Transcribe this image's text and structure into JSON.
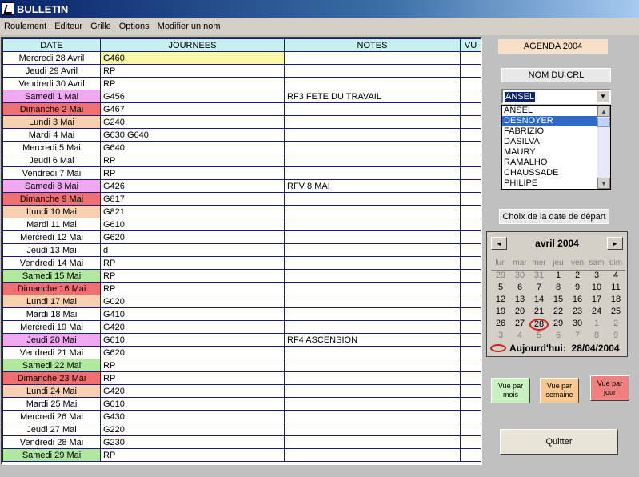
{
  "window": {
    "title": "BULLETIN"
  },
  "menu": [
    "Roulement",
    "Editeur",
    "Grille",
    "Options",
    "Modifier un nom"
  ],
  "grid": {
    "columns": [
      "DATE",
      "JOURNEES",
      "NOTES",
      "VU"
    ],
    "rows": [
      {
        "date": "Mercredi 28 Avril",
        "journee": "G460",
        "notes": "",
        "date_color": "#ffffff",
        "journee_color": "#f8f8a8"
      },
      {
        "date": "Jeudi 29 Avril",
        "journee": "RP",
        "notes": "",
        "date_color": "#ffffff"
      },
      {
        "date": "Vendredi 30 Avril",
        "journee": "RP",
        "notes": "",
        "date_color": "#ffffff"
      },
      {
        "date": "Samedi 1 Mai",
        "journee": "G456",
        "notes": "RF3 FETE DU TRAVAIL",
        "date_color": "#f0a8f0"
      },
      {
        "date": "Dimanche 2 Mai",
        "journee": "G467",
        "notes": "",
        "date_color": "#f07070"
      },
      {
        "date": "Lundi 3 Mai",
        "journee": "G240",
        "notes": "",
        "date_color": "#f8d0b0"
      },
      {
        "date": "Mardi 4 Mai",
        "journee": "G630 G640",
        "notes": "",
        "date_color": "#ffffff"
      },
      {
        "date": "Mercredi 5 Mai",
        "journee": "G640",
        "notes": "",
        "date_color": "#ffffff"
      },
      {
        "date": "Jeudi 6 Mai",
        "journee": "RP",
        "notes": "",
        "date_color": "#ffffff"
      },
      {
        "date": "Vendredi 7 Mai",
        "journee": "RP",
        "notes": "",
        "date_color": "#ffffff"
      },
      {
        "date": "Samedi 8 Mai",
        "journee": "G426",
        "notes": "RFV  8 MAI",
        "date_color": "#f0a8f0"
      },
      {
        "date": "Dimanche 9 Mai",
        "journee": "G817",
        "notes": "",
        "date_color": "#f07070"
      },
      {
        "date": "Lundi 10 Mai",
        "journee": "G821",
        "notes": "",
        "date_color": "#f8d0b0"
      },
      {
        "date": "Mardi 11 Mai",
        "journee": "G610",
        "notes": "",
        "date_color": "#ffffff"
      },
      {
        "date": "Mercredi 12 Mai",
        "journee": "G620",
        "notes": "",
        "date_color": "#ffffff"
      },
      {
        "date": "Jeudi 13 Mai",
        "journee": "d",
        "notes": "",
        "date_color": "#ffffff"
      },
      {
        "date": "Vendredi 14 Mai",
        "journee": "RP",
        "notes": "",
        "date_color": "#ffffff"
      },
      {
        "date": "Samedi 15 Mai",
        "journee": "RP",
        "notes": "",
        "date_color": "#b0e8a0"
      },
      {
        "date": "Dimanche 16 Mai",
        "journee": "RP",
        "notes": "",
        "date_color": "#f07070"
      },
      {
        "date": "Lundi 17 Mai",
        "journee": "G020",
        "notes": "",
        "date_color": "#f8d0b0"
      },
      {
        "date": "Mardi 18 Mai",
        "journee": "G410",
        "notes": "",
        "date_color": "#ffffff"
      },
      {
        "date": "Mercredi 19 Mai",
        "journee": "G420",
        "notes": "",
        "date_color": "#ffffff"
      },
      {
        "date": "Jeudi 20 Mai",
        "journee": "G610",
        "notes": "RF4  ASCENSION",
        "date_color": "#f0a8f0"
      },
      {
        "date": "Vendredi 21 Mai",
        "journee": "G620",
        "notes": "",
        "date_color": "#ffffff"
      },
      {
        "date": "Samedi 22 Mai",
        "journee": "RP",
        "notes": "",
        "date_color": "#b0e8a0"
      },
      {
        "date": "Dimanche 23 Mai",
        "journee": "RP",
        "notes": "",
        "date_color": "#f07070"
      },
      {
        "date": "Lundi 24 Mai",
        "journee": "G420",
        "notes": "",
        "date_color": "#f8d0b0"
      },
      {
        "date": "Mardi 25 Mai",
        "journee": "G010",
        "notes": "",
        "date_color": "#ffffff"
      },
      {
        "date": "Mercredi 26 Mai",
        "journee": "G430",
        "notes": "",
        "date_color": "#ffffff"
      },
      {
        "date": "Jeudi 27 Mai",
        "journee": "G220",
        "notes": "",
        "date_color": "#ffffff"
      },
      {
        "date": "Vendredi 28 Mai",
        "journee": "G230",
        "notes": "",
        "date_color": "#ffffff"
      },
      {
        "date": "Samedi 29 Mai",
        "journee": "RP",
        "notes": "",
        "date_color": "#b0e8a0"
      }
    ]
  },
  "panel": {
    "agenda_label": "AGENDA 2004",
    "nom_crl_label": "NOM DU CRL",
    "combo_value": "ANSEL",
    "names": [
      "ANSEL",
      "DESNOYER",
      "FABRIZIO",
      "DASILVA",
      "MAURY",
      "RAMALHO",
      "CHAUSSADE",
      "PHILIPE"
    ],
    "selected_name_index": 1,
    "choix_label": "Choix de la date de départ"
  },
  "calendar": {
    "month": "avril 2004",
    "days_of_week": [
      "lun",
      "mar",
      "mer",
      "jeu",
      "ven",
      "sam",
      "dim"
    ],
    "weeks": [
      [
        "29",
        "30",
        "31",
        "1",
        "2",
        "3",
        "4"
      ],
      [
        "5",
        "6",
        "7",
        "8",
        "9",
        "10",
        "11"
      ],
      [
        "12",
        "13",
        "14",
        "15",
        "16",
        "17",
        "18"
      ],
      [
        "19",
        "20",
        "21",
        "22",
        "23",
        "24",
        "25"
      ],
      [
        "26",
        "27",
        "28",
        "29",
        "30",
        "1",
        "2"
      ],
      [
        "3",
        "4",
        "5",
        "6",
        "7",
        "8",
        "9"
      ]
    ],
    "today_label": "Aujourd'hui:",
    "today_date": "28/04/2004"
  },
  "buttons": {
    "vue_mois": "Vue par mois",
    "vue_semaine": "Vue par semaine",
    "vue_jour": "Vue par jour",
    "quitter": "Quitter"
  }
}
